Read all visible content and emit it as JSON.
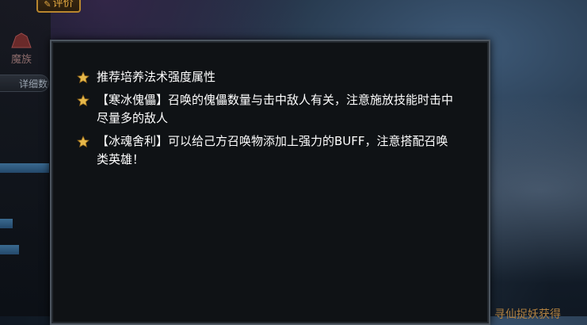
{
  "background": {
    "review_button_label": "评价",
    "race_label": "魔族",
    "detail_button_label": "详细数据",
    "bottom_text": "寻仙捉妖获得"
  },
  "panel": {
    "tips": [
      {
        "icon": "star-icon",
        "text": "推荐培养法术强度属性"
      },
      {
        "icon": "star-icon",
        "text": "【寒冰傀儡】召唤的傀儡数量与击中敌人有关，注意施放技能时击中尽量多的敌人"
      },
      {
        "icon": "star-icon",
        "text": "【冰魂舍利】可以给己方召唤物添加上强力的BUFF，注意搭配召唤类英雄！"
      }
    ]
  },
  "colors": {
    "star": "#e6b84a",
    "panel_bg": "#0f1215",
    "panel_border": "#4d5660",
    "tip_text": "#ffffff"
  }
}
